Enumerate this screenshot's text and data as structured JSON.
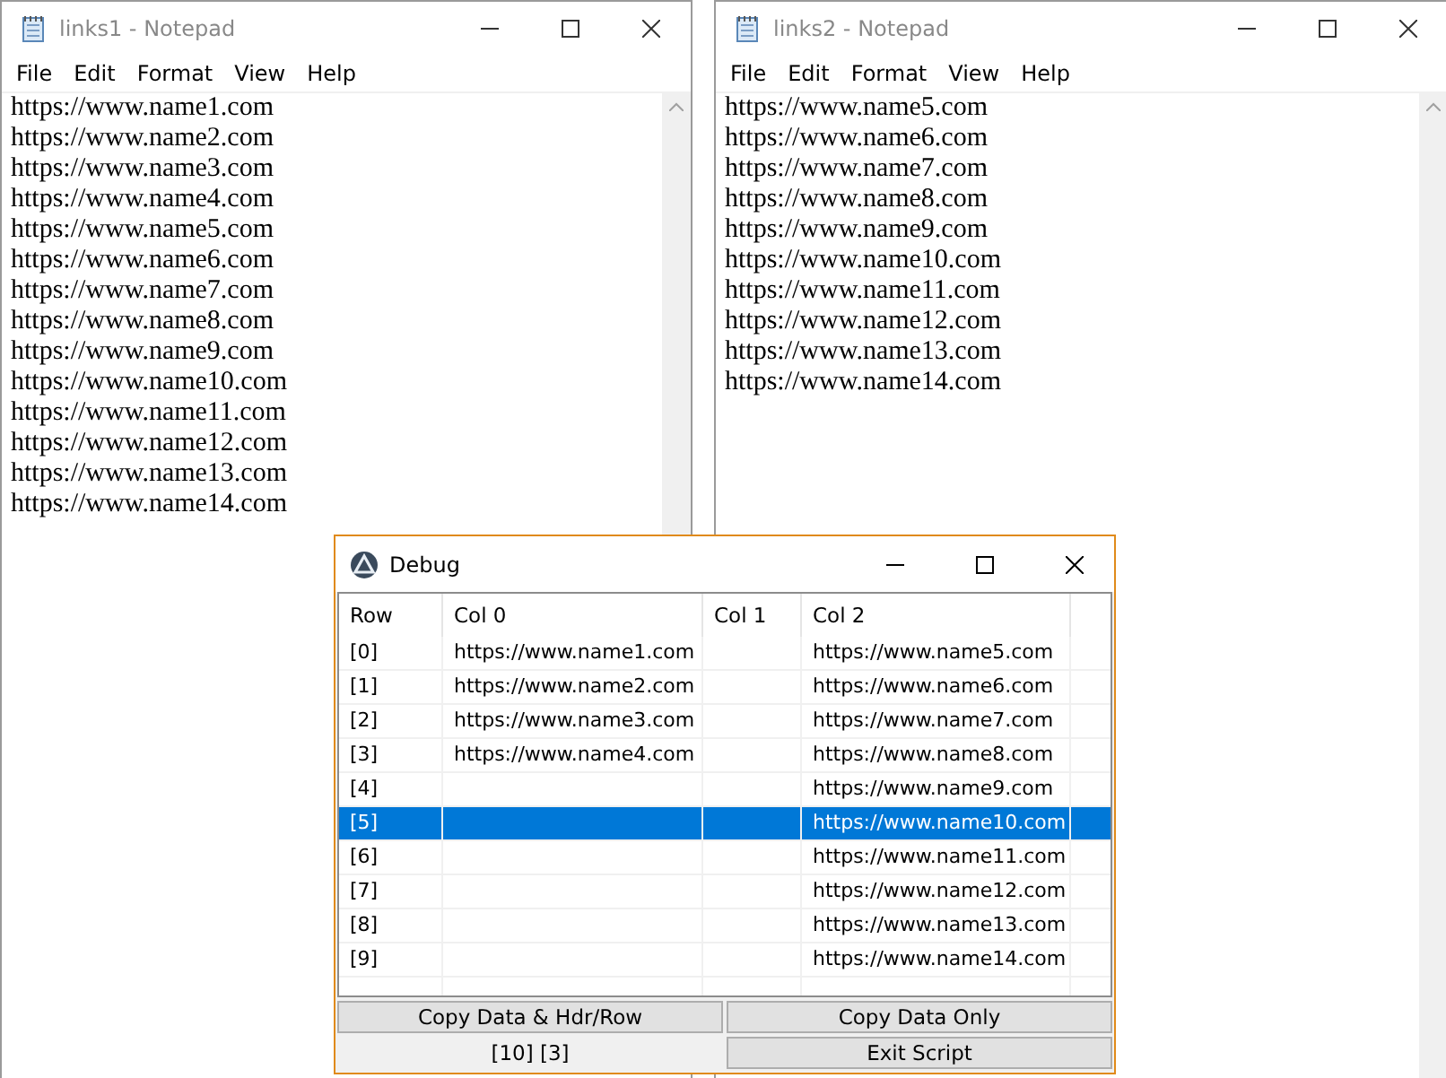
{
  "notepads": [
    {
      "title": "links1 - Notepad",
      "menu": [
        "File",
        "Edit",
        "Format",
        "View",
        "Help"
      ],
      "lines": [
        "https://www.name1.com",
        "https://www.name2.com",
        "https://www.name3.com",
        "https://www.name4.com",
        "https://www.name5.com",
        "https://www.name6.com",
        "https://www.name7.com",
        "https://www.name8.com",
        "https://www.name9.com",
        "https://www.name10.com",
        "https://www.name11.com",
        "https://www.name12.com",
        "https://www.name13.com",
        "https://www.name14.com"
      ]
    },
    {
      "title": "links2 - Notepad",
      "menu": [
        "File",
        "Edit",
        "Format",
        "View",
        "Help"
      ],
      "lines": [
        "https://www.name5.com",
        "https://www.name6.com",
        "https://www.name7.com",
        "https://www.name8.com",
        "https://www.name9.com",
        "https://www.name10.com",
        "https://www.name11.com",
        "https://www.name12.com",
        "https://www.name13.com",
        "https://www.name14.com"
      ]
    }
  ],
  "debug": {
    "title": "Debug",
    "columns": [
      "Row",
      "Col 0",
      "Col 1",
      "Col 2"
    ],
    "rows": [
      {
        "cells": [
          "[0]",
          "https://www.name1.com",
          "",
          "https://www.name5.com"
        ],
        "selected": false
      },
      {
        "cells": [
          "[1]",
          "https://www.name2.com",
          "",
          "https://www.name6.com"
        ],
        "selected": false
      },
      {
        "cells": [
          "[2]",
          "https://www.name3.com",
          "",
          "https://www.name7.com"
        ],
        "selected": false
      },
      {
        "cells": [
          "[3]",
          "https://www.name4.com",
          "",
          "https://www.name8.com"
        ],
        "selected": false
      },
      {
        "cells": [
          "[4]",
          "",
          "",
          "https://www.name9.com"
        ],
        "selected": false
      },
      {
        "cells": [
          "[5]",
          "",
          "",
          "https://www.name10.com"
        ],
        "selected": true
      },
      {
        "cells": [
          "[6]",
          "",
          "",
          "https://www.name11.com"
        ],
        "selected": false
      },
      {
        "cells": [
          "[7]",
          "",
          "",
          "https://www.name12.com"
        ],
        "selected": false
      },
      {
        "cells": [
          "[8]",
          "",
          "",
          "https://www.name13.com"
        ],
        "selected": false
      },
      {
        "cells": [
          "[9]",
          "",
          "",
          "https://www.name14.com"
        ],
        "selected": false
      }
    ],
    "footer": [
      {
        "kind": "button",
        "label": "Copy Data & Hdr/Row"
      },
      {
        "kind": "button",
        "label": "Copy Data Only"
      },
      {
        "kind": "label",
        "label": "[10] [3]"
      },
      {
        "kind": "button",
        "label": "Exit Script"
      }
    ]
  }
}
